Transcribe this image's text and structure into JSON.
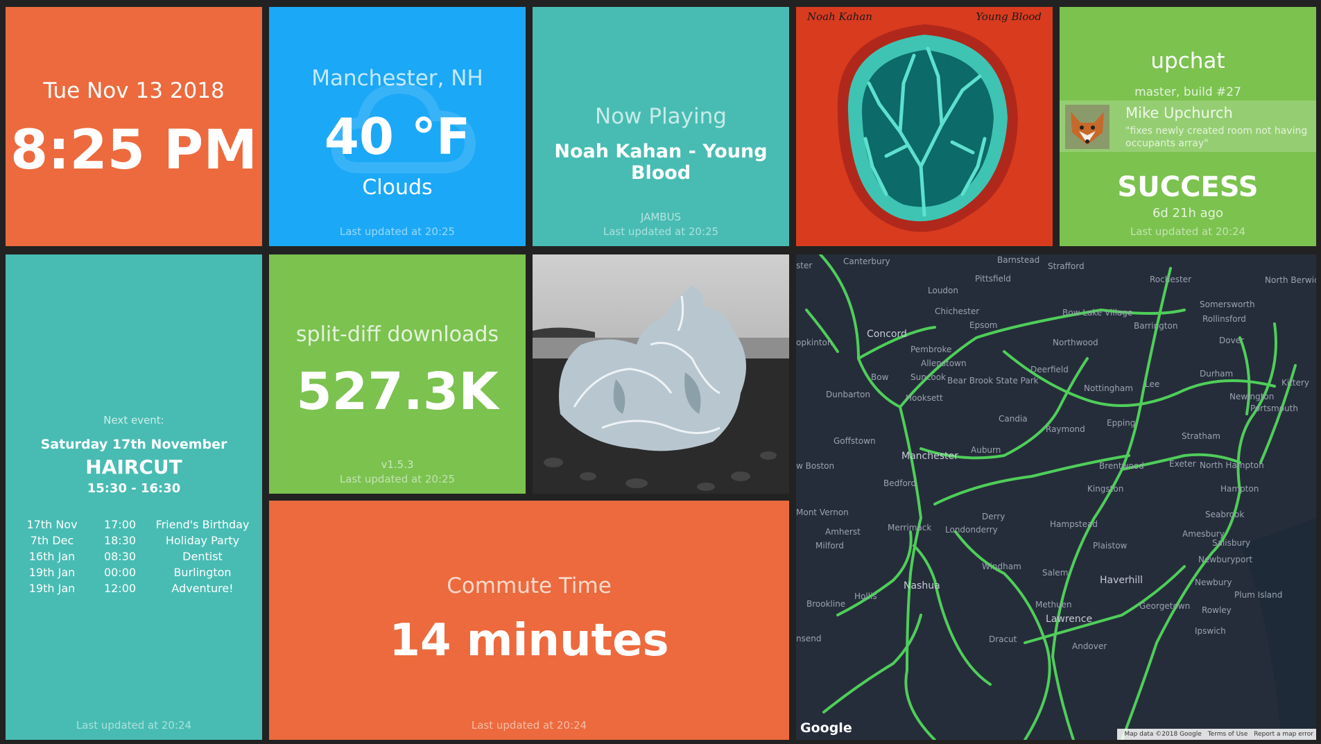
{
  "clock": {
    "date": "Tue Nov 13 2018",
    "time": "8:25 PM"
  },
  "weather": {
    "location": "Manchester, NH",
    "temperature": "40 °F",
    "condition": "Clouds",
    "icon": "cloud-icon",
    "updated": "Last updated at 20:25"
  },
  "now_playing": {
    "title": "Now Playing",
    "track": "Noah Kahan - Young Blood",
    "device": "JAMBUS",
    "updated": "Last updated at 20:25"
  },
  "album_art": {
    "artist": "Noah Kahan",
    "album": "Young Blood"
  },
  "ci": {
    "project": "upchat",
    "build": "master, build #27",
    "author": "Mike Upchurch",
    "message": "\"fixes newly created room not having occupants array\"",
    "status": "SUCCESS",
    "ago": "6d 21h ago",
    "updated": "Last updated at 20:24",
    "status_color": "#7bc24f"
  },
  "calendar": {
    "next_label": "Next event:",
    "next_date": "Saturday 17th November",
    "next_name": "HAIRCUT",
    "next_time": "15:30 - 16:30",
    "events": [
      {
        "date": "17th Nov",
        "time": "17:00",
        "name": "Friend's Birthday"
      },
      {
        "date": "7th Dec",
        "time": "18:30",
        "name": "Holiday Party"
      },
      {
        "date": "16th Jan",
        "time": "08:30",
        "name": "Dentist"
      },
      {
        "date": "19th Jan",
        "time": "00:00",
        "name": "Burlington"
      },
      {
        "date": "19th Jan",
        "time": "12:00",
        "name": "Adventure!"
      }
    ],
    "updated": "Last updated at 20:24"
  },
  "downloads": {
    "title": "split-diff downloads",
    "value": "527.3K",
    "version": "v1.5.3",
    "updated": "Last updated at 20:25"
  },
  "commute": {
    "title": "Commute Time",
    "value": "14 minutes",
    "updated": "Last updated at 20:24"
  },
  "map": {
    "places": {
      "canterbury": "Canterbury",
      "barnstead": "Barnstead",
      "strafford": "Strafford",
      "pittsfield": "Pittsfield",
      "loudon": "Loudon",
      "rochester": "Rochester",
      "north_berwick": "North Berwick",
      "chichester": "Chichester",
      "concord": "Concord",
      "epsom": "Epsom",
      "bow_lake": "Bow Lake Village",
      "barrington": "Barrington",
      "somersworth": "Somersworth",
      "rollinsford": "Rollinsford",
      "hopkinton": "opkinton",
      "pembroke": "Pembroke",
      "northwood": "Northwood",
      "dover": "Dover",
      "allenstown": "Allenstown",
      "deerfield": "Deerfield",
      "bow": "Bow",
      "suncook": "Suncook",
      "bear_brook": "Bear Brook State Park",
      "lee": "Lee",
      "durham": "Durham",
      "nottingham": "Nottingham",
      "dunbarton": "Dunbarton",
      "hooksett": "Hooksett",
      "newington": "Newington",
      "portsmouth": "Portsmouth",
      "kittery": "Kittery",
      "candia": "Candia",
      "epping": "Epping",
      "goffstown": "Goffstown",
      "raymond": "Raymond",
      "stratham": "Stratham",
      "manchester": "Manchester",
      "auburn": "Auburn",
      "boston": "w Boston",
      "brentwood": "Brentwood",
      "exeter": "Exeter",
      "north_hampton": "North Hampton",
      "bedford": "Bedford",
      "kingston": "Kingston",
      "hampton": "Hampton",
      "mont_vernon": "Mont Vernon",
      "seabrook": "Seabrook",
      "derry": "Derry",
      "hampstead": "Hampstead",
      "amherst": "Amherst",
      "merrimack": "Merrimack",
      "londonderry": "Londonderry",
      "amesbury": "Amesbury",
      "salisbury": "Salisbury",
      "milford": "Milford",
      "plaistow": "Plaistow",
      "newburyport": "Newburyport",
      "windham": "Windham",
      "salem": "Salem",
      "haverhill": "Haverhill",
      "nashua": "Nashua",
      "newbury": "Newbury",
      "plum_island": "Plum Island",
      "brookline": "Brookline",
      "hollis": "Hollis",
      "methuen": "Methuen",
      "georgetown": "Georgetown",
      "rowley": "Rowley",
      "lawrence": "Lawrence",
      "ipswich": "Ipswich",
      "townsend": "nsend",
      "dracut": "Dracut",
      "andover": "Andover",
      "ster": "ster"
    },
    "logo": "Google",
    "footer": [
      "Map data ©2018 Google",
      "Terms of Use",
      "Report a map error"
    ]
  }
}
